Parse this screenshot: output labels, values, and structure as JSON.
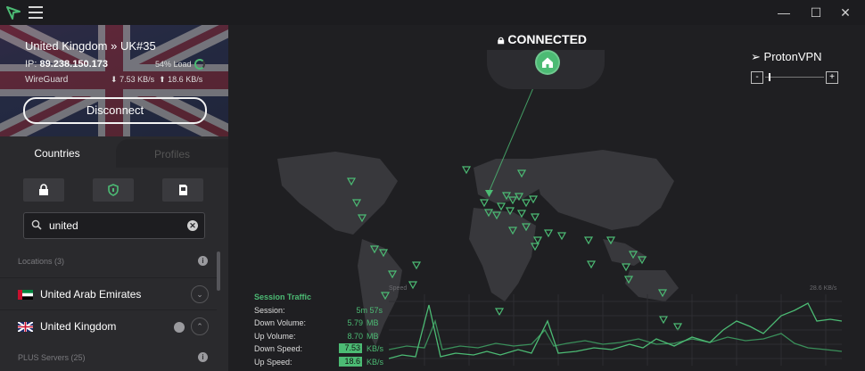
{
  "window": {
    "min_glyph": "—",
    "max_glyph": "☐",
    "close_glyph": "✕"
  },
  "server": {
    "name": "United Kingdom » UK#35",
    "ip_label": "IP: ",
    "ip": "89.238.150.173",
    "load": "54% Load",
    "protocol": "WireGuard",
    "down_speed": "7.53 KB/s",
    "up_speed": "18.6 KB/s"
  },
  "disconnect_label": "Disconnect",
  "tabs": {
    "countries": "Countries",
    "profiles": "Profiles"
  },
  "filters": [
    {
      "icon": "lock-icon"
    },
    {
      "icon": "shield-icon"
    },
    {
      "icon": "sd-card-icon"
    }
  ],
  "search": {
    "value": "united",
    "clear_glyph": "✕"
  },
  "sections": {
    "locations": "Locations (3)",
    "plus": "PLUS Servers (25)"
  },
  "countries": [
    {
      "name": "United Arab Emirates",
      "chevron": "⌄"
    },
    {
      "name": "United Kingdom",
      "chevron": "⌃"
    }
  ],
  "status": {
    "connected": "CONNECTED",
    "brand": "ProtonVPN",
    "zoom_minus": "-",
    "zoom_plus": "+"
  },
  "traffic": {
    "title": "Session Traffic",
    "session_label": "Session:",
    "session": "5m 57s",
    "down_volume_label": "Down Volume:",
    "down_volume": "5.79",
    "down_volume_unit": "MB",
    "up_volume_label": "Up Volume:",
    "up_volume": "8.70",
    "up_volume_unit": "MB",
    "down_speed_label": "Down Speed:",
    "down_speed": "7.53",
    "down_speed_unit": "KB/s",
    "up_speed_label": "Up Speed:",
    "up_speed": "18.6",
    "up_speed_unit": "KB/s",
    "graph_speed_label": "Speed",
    "graph_max": "28.6 KB/s"
  },
  "colors": {
    "accent": "#4cbb74",
    "background": "#1f1f22",
    "sidebar": "#2a2a2d"
  }
}
